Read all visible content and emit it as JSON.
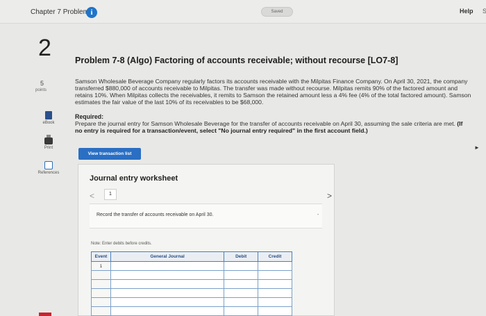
{
  "header": {
    "chapter_title": "Chapter 7 Problems",
    "info_icon_glyph": "i",
    "saved_label": "Saved",
    "help_label": "Help",
    "help_extra": "S"
  },
  "question": {
    "number": "2",
    "points_value": "5",
    "points_label": "points"
  },
  "tools": [
    {
      "label": "eBook",
      "icon": "book-icon"
    },
    {
      "label": "Print",
      "icon": "printer-icon"
    },
    {
      "label": "References",
      "icon": "references-icon"
    }
  ],
  "problem": {
    "title": "Problem 7-8 (Algo) Factoring of accounts receivable; without recourse [LO7-8]",
    "body": "Samson Wholesale Beverage Company regularly factors its accounts receivable with the Milpitas Finance Company. On April 30, 2021, the company transferred $880,000 of accounts receivable to Milpitas. The transfer was made without recourse. Milpitas remits 90% of the factored amount and retains 10%. When Milpitas collects the receivables, it remits to Samson the retained amount less a 4% fee (4% of the total factored amount). Samson estimates the fair value of the last 10% of its receivables to be $68,000.",
    "required_label": "Required:",
    "required_text": "Prepare the journal entry for Samson Wholesale Beverage for the transfer of accounts receivable on April 30, assuming the sale criteria are met.",
    "required_bold": "(If no entry is required for a transaction/event, select \"No journal entry required\" in the first account field.)"
  },
  "view_button_label": "View transaction list",
  "worksheet": {
    "title": "Journal entry worksheet",
    "prev_glyph": "<",
    "current_page": "1",
    "next_glyph": ">",
    "instruction": "Record the transfer of accounts receivable on April 30.",
    "instruction_mark": "-",
    "note": "Note: Enter debits before credits.",
    "columns": [
      "Event",
      "General Journal",
      "Debit",
      "Credit"
    ],
    "rows": [
      "1",
      "",
      "",
      "",
      "",
      ""
    ]
  },
  "colors": {
    "accent_blue": "#2a6fc3",
    "info_blue": "#1f74c9",
    "table_border": "#4a7fb8",
    "brand_red": "#c8242e"
  }
}
